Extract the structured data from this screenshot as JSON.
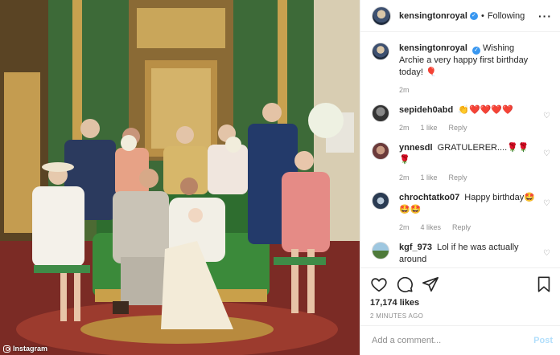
{
  "photo": {
    "description_icon": "photo",
    "watermark": "Instagram"
  },
  "header": {
    "username": "kensingtonroyal",
    "verified_icon": "verified-badge-icon",
    "separator": "•",
    "follow_state": "Following",
    "more_icon": "more-dots-icon"
  },
  "comments": [
    {
      "username": "kensingtonroyal",
      "text": "Wishing Archie a very happy first birthday today! 🎈",
      "time": "2m",
      "likes": "",
      "reply": ""
    },
    {
      "username": "sepideh0abd",
      "text": "👏❤️❤️❤️❤️",
      "time": "2m",
      "likes": "1 like",
      "reply": "Reply"
    },
    {
      "username": "ynnesdl",
      "text": "GRATULERER....🌹🌹🌹",
      "time": "2m",
      "likes": "1 like",
      "reply": "Reply"
    },
    {
      "username": "chrochtatko07",
      "text": "Happy birthday🤩🤩🤩",
      "time": "2m",
      "likes": "4 likes",
      "reply": "Reply"
    },
    {
      "username": "kgf_973",
      "text": "Lol if he was actually around",
      "time": "",
      "likes": "",
      "reply": ""
    }
  ],
  "actions": {
    "like_icon": "heart-icon",
    "comment_icon": "comment-bubble-icon",
    "share_icon": "paper-plane-icon",
    "save_icon": "bookmark-icon",
    "likes": "17,174 likes",
    "timestamp": "2 MINUTES AGO"
  },
  "add_comment": {
    "placeholder": "Add a comment...",
    "post_label": "Post"
  },
  "colors": {
    "accent": "#3897f0",
    "post_disabled": "#b2dffc",
    "muted": "#8e8e8e"
  }
}
